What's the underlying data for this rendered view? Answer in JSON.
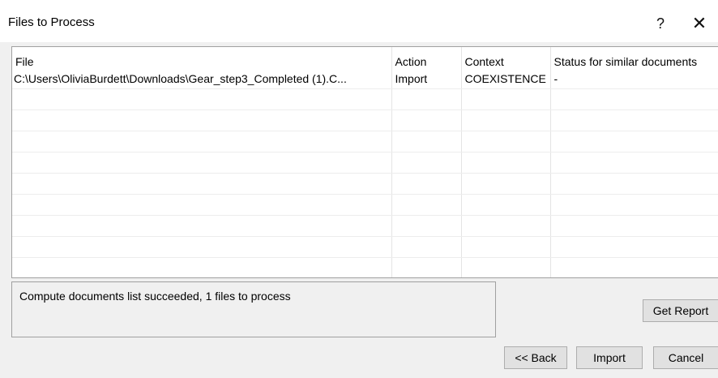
{
  "window": {
    "title": "Files to Process",
    "help_label": "?",
    "close_label": "✕"
  },
  "table": {
    "headers": {
      "file": "File",
      "action": "Action",
      "context": "Context",
      "status": "Status for similar documents"
    },
    "rows": [
      {
        "file": "C:\\Users\\OliviaBurdett\\Downloads\\Gear_step3_Completed (1).C...",
        "action": "Import",
        "context": "COEXISTENCE",
        "status": "-"
      }
    ]
  },
  "status_message": "Compute documents list succeeded, 1 files to process",
  "buttons": {
    "get_report": "Get Report",
    "back": "<< Back",
    "import": "Import",
    "cancel": "Cancel"
  }
}
